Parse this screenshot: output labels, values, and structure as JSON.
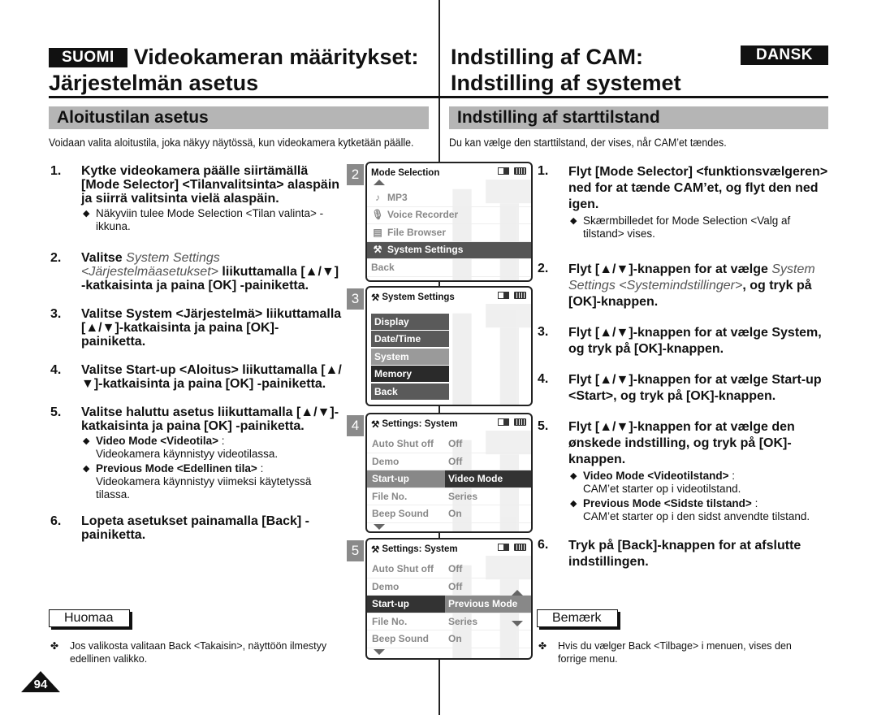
{
  "page_number": "94",
  "left": {
    "lang": "SUOMI",
    "title_line1": "Videokameran määritykset:",
    "title_line2": "Järjestelmän asetus",
    "section": "Aloitustilan asetus",
    "intro": "Voidaan valita aloitustila, joka näkyy näytössä, kun videokamera kytketään päälle.",
    "steps": [
      {
        "num": "1.",
        "text": "Kytke videokamera päälle siirtämällä [Mode Selector] <Tilanvalitsinta> alaspäin ja siirrä valitsinta vielä alaspäin.",
        "bullets": [
          {
            "text": "Näkyviin tulee Mode Selection <Tilan valinta> -ikkuna."
          }
        ]
      },
      {
        "num": "2.",
        "pre": "Valitse ",
        "italic": "System Settings <Järjestelmäasetukset>",
        "post": " liikuttamalla [▲/▼] -katkaisinta ja paina [OK] -painiketta."
      },
      {
        "num": "3.",
        "text": "Valitse System <Järjestelmä> liikuttamalla [▲/▼]-katkaisinta ja paina [OK]-painiketta."
      },
      {
        "num": "4.",
        "text": "Valitse Start-up <Aloitus> liikuttamalla [▲/▼]-katkaisinta ja paina [OK] -painiketta."
      },
      {
        "num": "5.",
        "text": "Valitse haluttu asetus liikuttamalla [▲/▼]-katkaisinta ja paina [OK] -painiketta.",
        "bullets": [
          {
            "bold": "Video Mode <Videotila>",
            "sep": " :",
            "text": "Videokamera käynnistyy videotilassa."
          },
          {
            "bold": "Previous Mode <Edellinen tila>",
            "sep": " :",
            "text": "Videokamera käynnistyy viimeksi käytetyssä tilassa."
          }
        ]
      },
      {
        "num": "6.",
        "text": "Lopeta asetukset painamalla [Back] -painiketta."
      }
    ],
    "note_label": "Huomaa",
    "note_text": "Jos valikosta valitaan Back <Takaisin>, näyttöön ilmestyy edellinen valikko."
  },
  "right": {
    "lang": "DANSK",
    "title_line1": "Indstilling af CAM:",
    "title_line2": "Indstilling af systemet",
    "section": "Indstilling af starttilstand",
    "intro": "Du kan vælge den starttilstand, der vises, når CAM’et tændes.",
    "steps": [
      {
        "num": "1.",
        "text": "Flyt [Mode Selector] <funktionsvælgeren> ned for at tænde CAM’et, og flyt den ned igen.",
        "bullets": [
          {
            "text": "Skærmbilledet for Mode Selection <Valg af tilstand> vises."
          }
        ]
      },
      {
        "num": "2.",
        "pre": "Flyt [▲/▼]-knappen for at vælge ",
        "italic": "System Settings <Systemindstillinger>",
        "post": ", og tryk på [OK]-knappen."
      },
      {
        "num": "3.",
        "text": "Flyt [▲/▼]-knappen for at vælge System, og tryk på [OK]-knappen."
      },
      {
        "num": "4.",
        "text": "Flyt [▲/▼]-knappen for at vælge Start-up <Start>, og tryk på [OK]-knappen."
      },
      {
        "num": "5.",
        "text": "Flyt [▲/▼]-knappen for at vælge den ønskede indstilling, og tryk på [OK]-knappen.",
        "bullets": [
          {
            "bold": "Video Mode <Videotilstand>",
            "sep": " :",
            "text": "CAM’et starter op i videotilstand."
          },
          {
            "bold": "Previous Mode <Sidste tilstand>",
            "sep": " :",
            "text": "CAM’et starter op i den sidst anvendte tilstand."
          }
        ]
      },
      {
        "num": "6.",
        "text": "Tryk på [Back]-knappen for at afslutte indstillingen."
      }
    ],
    "note_label": "Bemærk",
    "note_text": "Hvis du vælger Back <Tilbage> i menuen, vises den forrige menu."
  },
  "screens": [
    {
      "num": "2",
      "title": "Mode Selection",
      "items": [
        {
          "icon": "music-note-icon",
          "glyph": "♪",
          "label": "MP3"
        },
        {
          "icon": "microphone-icon",
          "glyph": "🎙",
          "label": "Voice Recorder"
        },
        {
          "icon": "file-icon",
          "glyph": "▤",
          "label": "File Browser"
        },
        {
          "icon": "settings-tools-icon",
          "glyph": "⚒",
          "label": "System Settings",
          "selected": true
        },
        {
          "label": "Back"
        }
      ]
    },
    {
      "num": "3",
      "title": "System Settings",
      "items": [
        {
          "label": "Display",
          "shade": "#5a5a5a"
        },
        {
          "label": "Date/Time",
          "shade": "#5a5a5a"
        },
        {
          "label": "System",
          "shade": "#9a9a9a"
        },
        {
          "label": "Memory",
          "shade": "#2a2a2a"
        },
        {
          "label": "Back",
          "shade": "#5a5a5a"
        }
      ]
    },
    {
      "num": "4",
      "title": "Settings: System",
      "rows": [
        {
          "key": "Auto Shut off",
          "value": "Off"
        },
        {
          "key": "Demo",
          "value": "Off"
        },
        {
          "key": "Start-up",
          "value": "Video Mode",
          "selected": true
        },
        {
          "key": "File No.",
          "value": "Series"
        },
        {
          "key": "Beep Sound",
          "value": "On"
        }
      ]
    },
    {
      "num": "5",
      "title": "Settings: System",
      "rows": [
        {
          "key": "Auto Shut off",
          "value": "Off"
        },
        {
          "key": "Demo",
          "value": "Off"
        },
        {
          "key": "Start-up",
          "value": "Previous Mode",
          "selected": true
        },
        {
          "key": "File No.",
          "value": "Series"
        },
        {
          "key": "Beep Sound",
          "value": "On"
        }
      ]
    }
  ]
}
